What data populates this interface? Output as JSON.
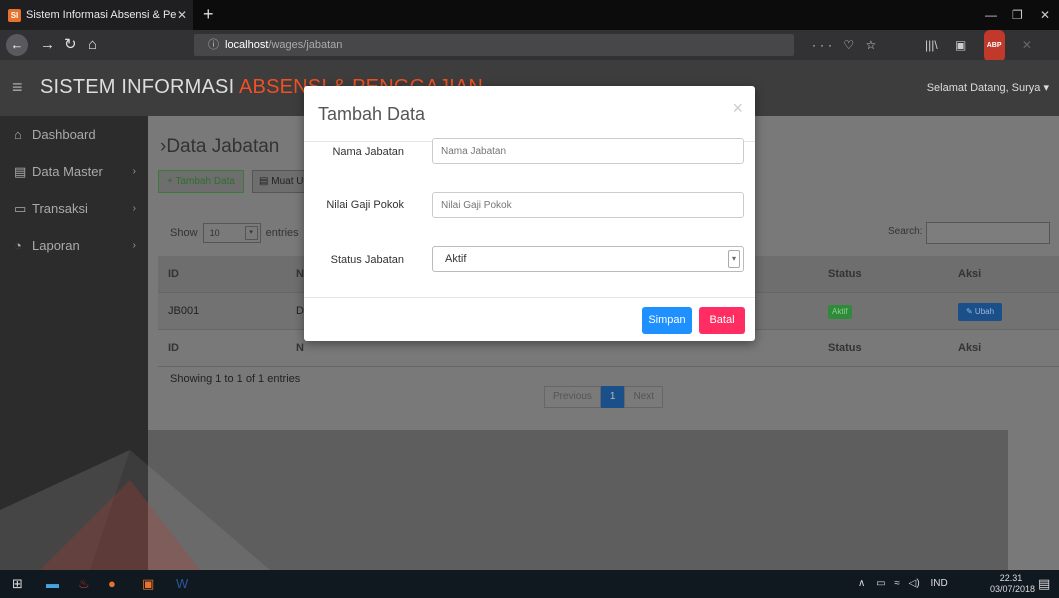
{
  "browser": {
    "tab_title": "Sistem Informasi Absensi & Pe",
    "new_tab": "+",
    "url_host": "localhost",
    "url_path": "/wages/jabatan",
    "info_icon": "ⓘ",
    "minimize": "—",
    "maximize": "❐",
    "close": "✕"
  },
  "app": {
    "title_main": "SISTEM INFORMASI ",
    "title_accent": "ABSENSI & PENGGAJIAN",
    "greeting": "Selamat Datang, Surya ▾"
  },
  "sidebar": {
    "items": [
      {
        "label": "Dashboard"
      },
      {
        "label": "Data Master"
      },
      {
        "label": "Transaksi"
      },
      {
        "label": "Laporan"
      }
    ]
  },
  "page": {
    "title": "Data Jabatan",
    "add_button": "+ Tambah Data",
    "load_button": "Muat U",
    "show_label": "Show",
    "show_value": "10",
    "entries_label": "entries",
    "search_label": "Search:",
    "showing_text": "Showing 1 to 1 of 1 entries",
    "pager": {
      "previous": "Previous",
      "current": "1",
      "next": "Next"
    }
  },
  "table": {
    "headers": [
      "ID",
      "Na",
      "Status",
      "Aksi"
    ],
    "footers": [
      "ID",
      "N",
      "Status",
      "Aksi"
    ],
    "rows": [
      {
        "id": "JB001",
        "name": "Di",
        "status": "Aktif",
        "action": "✎ Ubah"
      }
    ]
  },
  "modal": {
    "title": "Tambah Data",
    "close": "×",
    "fields": [
      {
        "label": "Nama Jabatan",
        "placeholder": "Nama Jabatan"
      },
      {
        "label": "Nilai Gaji Pokok",
        "placeholder": "Nilai Gaji Pokok"
      }
    ],
    "status_label": "Status Jabatan",
    "status_value": "Aktif",
    "save": "Simpan",
    "cancel": "Batal"
  },
  "taskbar": {
    "lang": "IND",
    "time": "22.31",
    "date": "03/07/2018"
  },
  "colors": {
    "accent": "#f05023",
    "save": "#1e90ff",
    "cancel": "#ff2d61"
  }
}
